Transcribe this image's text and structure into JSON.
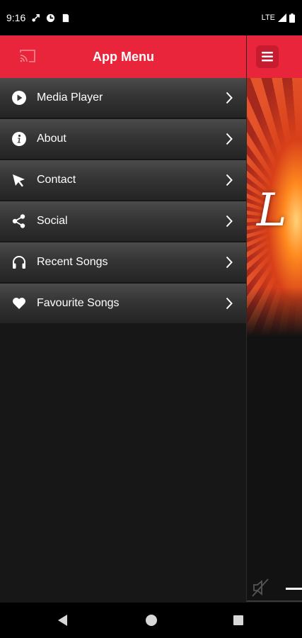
{
  "status_bar": {
    "time": "9:16",
    "network": "LTE"
  },
  "drawer": {
    "title": "App Menu",
    "items": [
      {
        "label": "Media Player",
        "icon": "play-icon"
      },
      {
        "label": "About",
        "icon": "info-icon"
      },
      {
        "label": "Contact",
        "icon": "cursor-icon"
      },
      {
        "label": "Social",
        "icon": "share-icon"
      },
      {
        "label": "Recent Songs",
        "icon": "headphones-icon"
      },
      {
        "label": "Favourite Songs",
        "icon": "heart-icon"
      }
    ]
  },
  "background_app": {
    "hero_text": "L"
  },
  "colors": {
    "accent": "#e8253b",
    "drawer_bg": "#171717"
  }
}
